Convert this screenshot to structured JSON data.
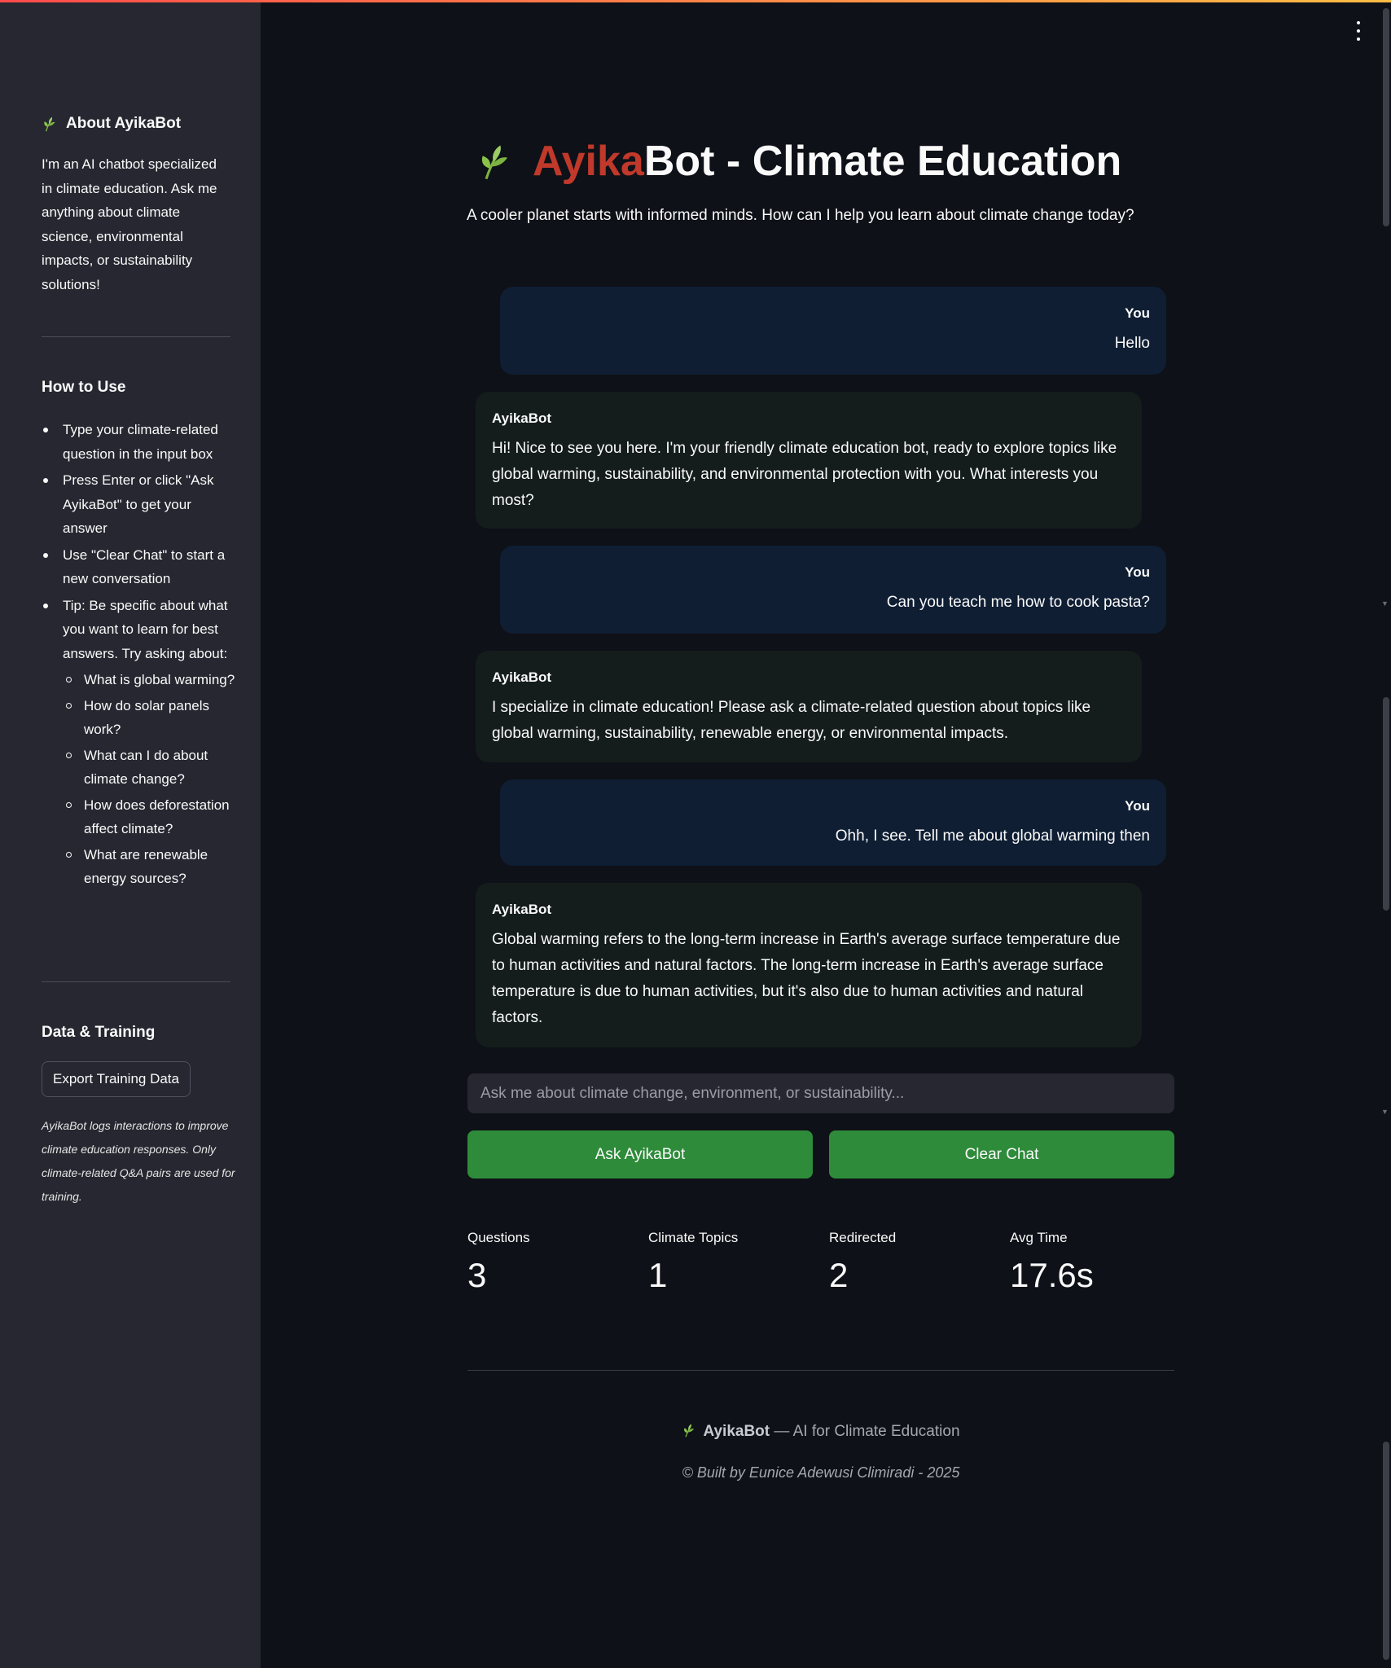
{
  "sidebar": {
    "about_title": "About AyikaBot",
    "about_text": "I'm an AI chatbot specialized in climate education. Ask me anything about climate science, environmental impacts, or sustainability solutions!",
    "howto_title": "How to Use",
    "howto_items": [
      "Type your climate-related question in the input box",
      "Press Enter or click \"Ask AyikaBot\" to get your answer",
      "Use \"Clear Chat\" to start a new conversation",
      "Tip: Be specific about what you want to learn for best answers. Try asking about:"
    ],
    "suggestions": [
      "What is global warming?",
      "How do solar panels work?",
      "What can I do about climate change?",
      "How does deforestation affect climate?",
      "What are renewable energy sources?"
    ],
    "data_title": "Data & Training",
    "export_label": "Export Training Data",
    "note": "AyikaBot logs interactions to improve climate education responses. Only climate-related Q&A pairs are used for training."
  },
  "header": {
    "title_accent": "Ayika",
    "title_rest": "Bot - Climate Education",
    "subtitle": "A cooler planet starts with informed minds. How can I help you learn about climate change today?"
  },
  "messages": [
    {
      "role": "user",
      "author": "You",
      "text": "Hello"
    },
    {
      "role": "bot",
      "author": "AyikaBot",
      "text": "Hi! Nice to see you here. I'm your friendly climate education bot, ready to explore topics like global warming, sustainability, and environmental protection with you. What interests you most?"
    },
    {
      "role": "user",
      "author": "You",
      "text": "Can you teach me how to cook pasta?"
    },
    {
      "role": "bot",
      "author": "AyikaBot",
      "text": "I specialize in climate education! Please ask a climate-related question about topics like global warming, sustainability, renewable energy, or environmental impacts."
    },
    {
      "role": "user",
      "author": "You",
      "text": "Ohh, I see. Tell me about global warming then"
    },
    {
      "role": "bot",
      "author": "AyikaBot",
      "text": "Global warming refers to the long-term increase in Earth's average surface temperature due to human activities and natural factors. The long-term increase in Earth's average surface temperature is due to human activities, but it's also due to human activities and natural factors."
    }
  ],
  "input": {
    "placeholder": "Ask me about climate change, environment, or sustainability...",
    "value": ""
  },
  "buttons": {
    "ask": "Ask AyikaBot",
    "clear": "Clear Chat"
  },
  "metrics": [
    {
      "label": "Questions",
      "value": "3"
    },
    {
      "label": "Climate Topics",
      "value": "1"
    },
    {
      "label": "Redirected",
      "value": "2"
    },
    {
      "label": "Avg Time",
      "value": "17.6s"
    }
  ],
  "footer": {
    "brand": "AyikaBot",
    "tagline": " — AI for Climate Education",
    "copyright": "© Built by Eunice Adewusi Climiradi - 2025"
  },
  "icons": {
    "brand": "seedling-icon",
    "menu": "kebab-menu-icon"
  },
  "colors": {
    "background": "#0e1117",
    "sidebar": "#262730",
    "accent_red": "#c0392b",
    "button_green": "#2e8b3a",
    "user_bubble": "#0f1e33",
    "bot_bubble": "#141d1b"
  }
}
